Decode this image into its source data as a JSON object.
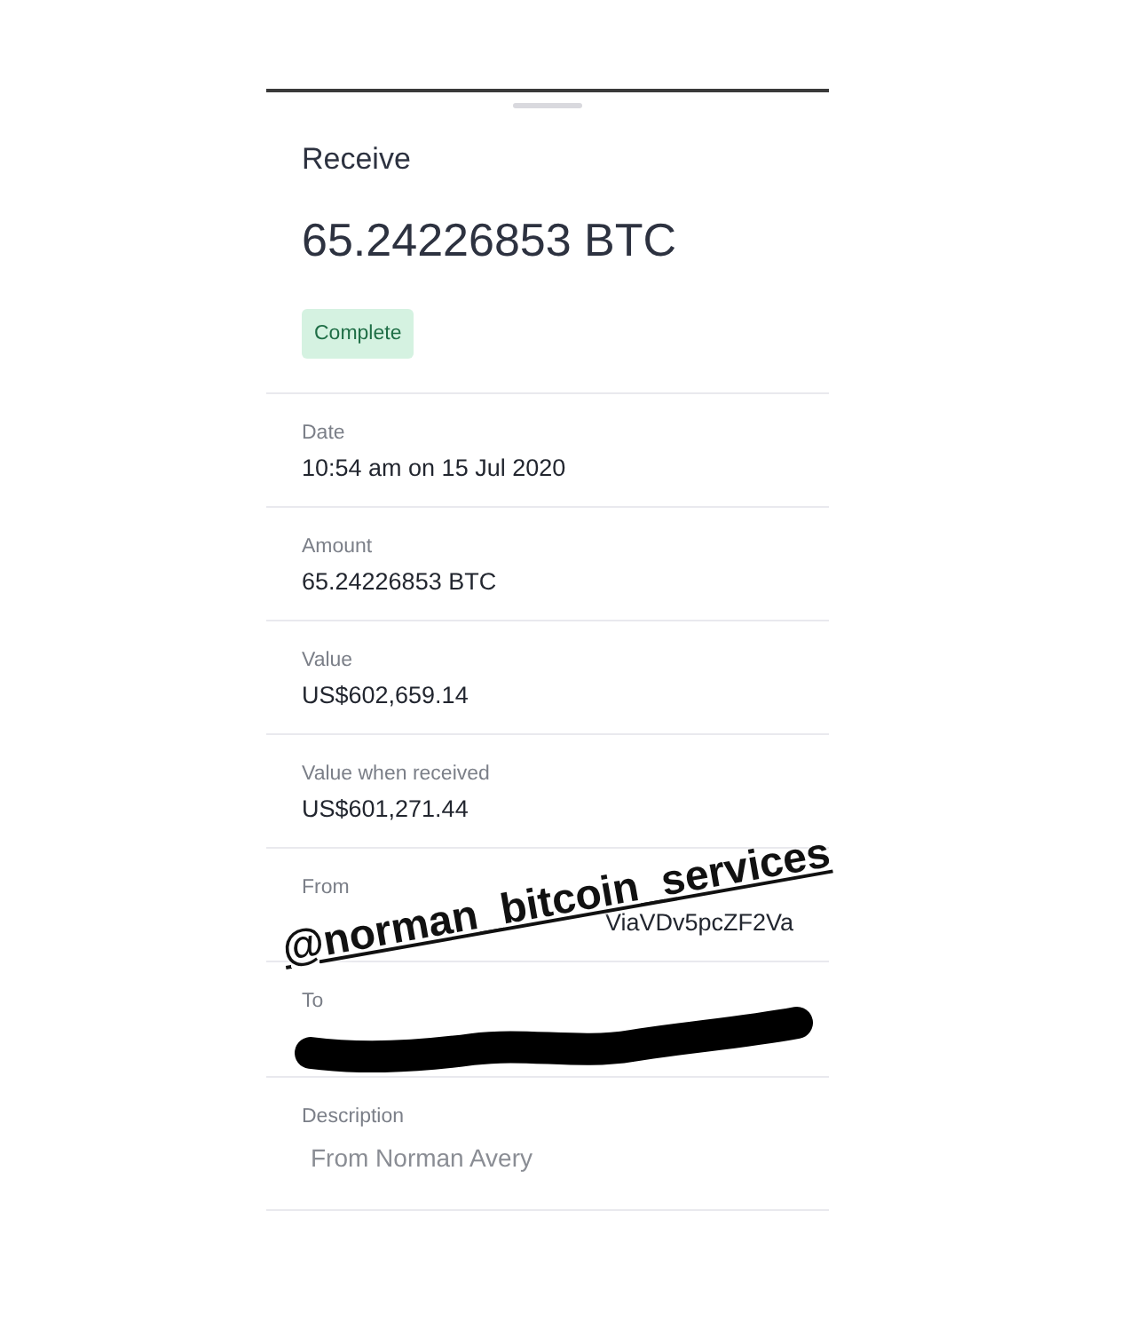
{
  "sheet": {
    "title": "Receive",
    "amount": "65.24226853 BTC",
    "status": {
      "label": "Complete",
      "kind": "complete"
    }
  },
  "fields": [
    {
      "label": "Date",
      "value": "10:54 am on 15 Jul 2020",
      "kind": "plain",
      "redacted": false
    },
    {
      "label": "Amount",
      "value": "65.24226853 BTC",
      "kind": "plain",
      "redacted": false
    },
    {
      "label": "Value",
      "value": "US$602,659.14",
      "kind": "plain",
      "redacted": false
    },
    {
      "label": "Value when received",
      "value": "US$601,271.44",
      "kind": "plain",
      "redacted": false
    },
    {
      "label": "From",
      "value": "ViaVDv5pcZF2Va",
      "kind": "covered",
      "redacted": false
    },
    {
      "label": "To",
      "kind": "plain",
      "redacted": true
    },
    {
      "label": "Description",
      "value": "From Norman Avery",
      "kind": "note",
      "redacted": false
    }
  ],
  "overlay_caption": "@norman_bitcoin_services"
}
